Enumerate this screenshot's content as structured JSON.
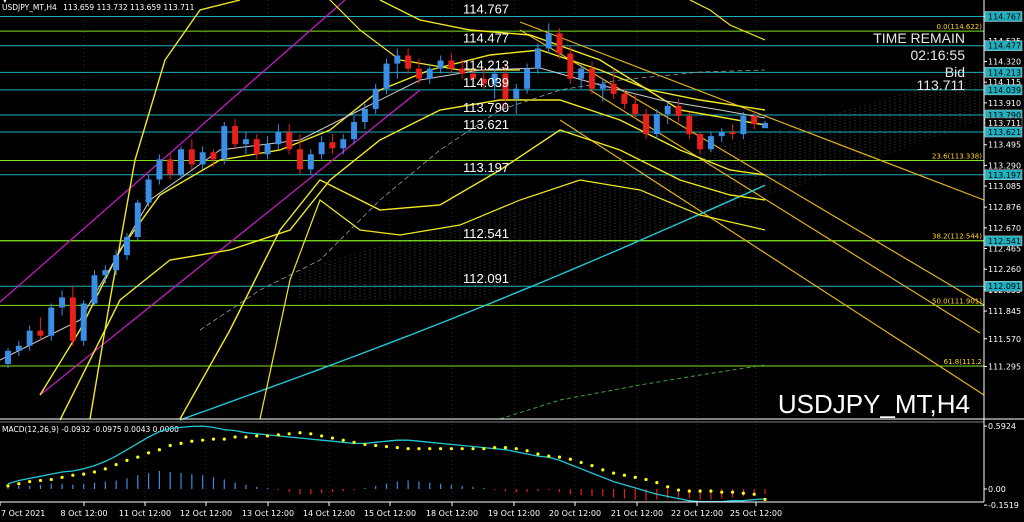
{
  "header": {
    "symbol_tf": "USDJPY_MT,H4",
    "ohlc": "113.659 113.732 113.659 113.711"
  },
  "watermark": "USDJPY_MT,H4",
  "timer": {
    "label": "TIME REMAIN",
    "time": "02:16:55",
    "bid_label": "Bid",
    "bid": "113.711"
  },
  "macd_header": "MACD(12,26,9) -0.0932 -0.0975 0.0043 0.0000",
  "colors": {
    "background": "#000000",
    "bull": "#3a8ee6",
    "bear": "#e8201a",
    "ma_long": "#22c7d6",
    "bands": "#f2ea1f",
    "channel": "#d11ad1",
    "trend": "#e0b21c",
    "hline_cyan": "#1fb0c0",
    "hline_green": "#7ee21f",
    "macd_line": "#22c7d6",
    "macd_signal": "#ffff00"
  },
  "chart_data": [
    {
      "type": "line",
      "title": "USDJPY_MT,H4",
      "x": [
        "7 Oct 2021",
        "8 Oct 12:00",
        "11 Oct 12:00",
        "12 Oct 12:00",
        "13 Oct 12:00",
        "14 Oct 12:00",
        "15 Oct 12:00",
        "18 Oct 12:00",
        "19 Oct 12:00",
        "20 Oct 12:00",
        "21 Oct 12:00",
        "22 Oct 12:00",
        "25 Oct 12:00"
      ],
      "y_ticks": [
        "114.767",
        "114.525",
        "114.320",
        "114.115",
        "113.910",
        "113.711",
        "113.495",
        "113.290",
        "113.085",
        "112.876",
        "112.670",
        "112.465",
        "112.260",
        "112.055",
        "111.845",
        "111.570",
        "111.295"
      ],
      "ylim": [
        111.24,
        114.92
      ],
      "price_lines": [
        {
          "label": "114.767",
          "value": 114.767,
          "color": "cyan"
        },
        {
          "label": "114.477",
          "value": 114.477,
          "color": "cyan"
        },
        {
          "label": "114.213",
          "value": 114.213,
          "color": "cyan"
        },
        {
          "label": "114.039",
          "value": 114.039,
          "color": "cyan"
        },
        {
          "label": "113.790",
          "value": 113.79,
          "color": "cyan"
        },
        {
          "label": "113.621",
          "value": 113.621,
          "color": "cyan"
        },
        {
          "label": "113.197",
          "value": 113.197,
          "color": "cyan"
        },
        {
          "label": "112.541",
          "value": 112.541,
          "color": "green"
        },
        {
          "label": "112.091",
          "value": 112.091,
          "color": "cyan"
        }
      ],
      "right_tags": [
        {
          "label": "114.767",
          "value": 114.767
        },
        {
          "label": "114.477",
          "value": 114.477
        },
        {
          "label": "114.213",
          "value": 114.213
        },
        {
          "label": "114.039",
          "value": 114.039
        },
        {
          "label": "113.790",
          "value": 113.79
        },
        {
          "label": "113.711",
          "value": 113.711
        },
        {
          "label": "113.621",
          "value": 113.621
        },
        {
          "label": "113.197",
          "value": 113.197
        },
        {
          "label": "112.541",
          "value": 112.541
        },
        {
          "label": "112.091",
          "value": 112.091
        }
      ],
      "fibo": [
        {
          "label": "0.0(114.622)",
          "value": 114.622
        },
        {
          "label": "23.6(113.338)",
          "value": 113.338
        },
        {
          "label": "38.2(112.544)",
          "value": 112.544
        },
        {
          "label": "50.0(111.901)",
          "value": 111.901
        },
        {
          "label": "61.8(111.2",
          "value": 111.3
        }
      ],
      "candles": [
        [
          111.32,
          111.48,
          111.28,
          111.45
        ],
        [
          111.45,
          111.55,
          111.4,
          111.5
        ],
        [
          111.5,
          111.7,
          111.45,
          111.65
        ],
        [
          111.65,
          111.78,
          111.55,
          111.6
        ],
        [
          111.6,
          111.92,
          111.55,
          111.88
        ],
        [
          111.88,
          112.05,
          111.8,
          111.98
        ],
        [
          111.98,
          112.1,
          111.5,
          111.55
        ],
        [
          111.55,
          111.95,
          111.5,
          111.92
        ],
        [
          111.92,
          112.25,
          111.9,
          112.2
        ],
        [
          112.2,
          112.3,
          112.12,
          112.25
        ],
        [
          112.25,
          112.45,
          112.2,
          112.4
        ],
        [
          112.4,
          112.62,
          112.35,
          112.58
        ],
        [
          112.58,
          112.95,
          112.55,
          112.92
        ],
        [
          112.92,
          113.2,
          112.88,
          113.15
        ],
        [
          113.15,
          113.4,
          113.1,
          113.35
        ],
        [
          113.35,
          113.42,
          113.15,
          113.2
        ],
        [
          113.2,
          113.48,
          113.15,
          113.45
        ],
        [
          113.45,
          113.55,
          113.25,
          113.3
        ],
        [
          113.3,
          113.48,
          113.25,
          113.42
        ],
        [
          113.42,
          113.45,
          113.28,
          113.35
        ],
        [
          113.35,
          113.72,
          113.3,
          113.68
        ],
        [
          113.68,
          113.75,
          113.45,
          113.5
        ],
        [
          113.5,
          113.62,
          113.4,
          113.55
        ],
        [
          113.55,
          113.6,
          113.35,
          113.4
        ],
        [
          113.4,
          113.58,
          113.35,
          113.5
        ],
        [
          113.5,
          113.7,
          113.45,
          113.62
        ],
        [
          113.62,
          113.7,
          113.4,
          113.45
        ],
        [
          113.45,
          113.6,
          113.2,
          113.25
        ],
        [
          113.25,
          113.45,
          113.2,
          113.4
        ],
        [
          113.4,
          113.58,
          113.35,
          113.52
        ],
        [
          113.52,
          113.6,
          113.4,
          113.46
        ],
        [
          113.46,
          113.6,
          113.4,
          113.55
        ],
        [
          113.55,
          113.78,
          113.5,
          113.72
        ],
        [
          113.72,
          113.9,
          113.65,
          113.85
        ],
        [
          113.85,
          114.1,
          113.8,
          114.05
        ],
        [
          114.05,
          114.35,
          114.0,
          114.3
        ],
        [
          114.3,
          114.45,
          114.15,
          114.38
        ],
        [
          114.38,
          114.45,
          114.2,
          114.25
        ],
        [
          114.25,
          114.35,
          114.1,
          114.15
        ],
        [
          114.15,
          114.3,
          114.1,
          114.25
        ],
        [
          114.25,
          114.38,
          114.2,
          114.33
        ],
        [
          114.33,
          114.4,
          114.2,
          114.25
        ],
        [
          114.25,
          114.35,
          114.15,
          114.2
        ],
        [
          114.2,
          114.3,
          114.1,
          114.15
        ],
        [
          114.15,
          114.25,
          114.05,
          114.1
        ],
        [
          114.1,
          114.25,
          113.95,
          114.2
        ],
        [
          114.2,
          114.3,
          113.85,
          113.95
        ],
        [
          113.95,
          114.1,
          113.8,
          114.05
        ],
        [
          114.05,
          114.3,
          114.0,
          114.25
        ],
        [
          114.25,
          114.5,
          114.2,
          114.45
        ],
        [
          114.45,
          114.7,
          114.4,
          114.6
        ],
        [
          114.6,
          114.65,
          114.35,
          114.4
        ],
        [
          114.4,
          114.48,
          114.1,
          114.15
        ],
        [
          114.15,
          114.3,
          114.05,
          114.25
        ],
        [
          114.25,
          114.32,
          114.0,
          114.05
        ],
        [
          114.05,
          114.15,
          113.92,
          114.1
        ],
        [
          114.1,
          114.25,
          113.95,
          114.0
        ],
        [
          114.0,
          114.05,
          113.85,
          113.9
        ],
        [
          113.9,
          114.0,
          113.75,
          113.8
        ],
        [
          113.8,
          113.85,
          113.55,
          113.6
        ],
        [
          113.6,
          113.85,
          113.55,
          113.8
        ],
        [
          113.8,
          113.92,
          113.7,
          113.88
        ],
        [
          113.88,
          113.95,
          113.72,
          113.78
        ],
        [
          113.78,
          113.82,
          113.55,
          113.6
        ],
        [
          113.6,
          113.62,
          113.4,
          113.45
        ],
        [
          113.45,
          113.62,
          113.42,
          113.58
        ],
        [
          113.58,
          113.66,
          113.52,
          113.62
        ],
        [
          113.62,
          113.7,
          113.55,
          113.6
        ],
        [
          113.6,
          113.82,
          113.55,
          113.78
        ],
        [
          113.78,
          113.82,
          113.65,
          113.7
        ],
        [
          113.659,
          113.732,
          113.659,
          113.711
        ]
      ]
    },
    {
      "type": "bar",
      "title": "MACD(12,26,9) -0.0932 -0.0975 0.0043 0.0000",
      "y_ticks": [
        "0.5924",
        "0.00",
        "-0.1519"
      ],
      "ylim": [
        -0.18,
        0.64
      ],
      "histogram": [
        0.02,
        0.03,
        0.03,
        0.04,
        0.05,
        0.05,
        0.04,
        0.05,
        0.06,
        0.07,
        0.08,
        0.1,
        0.13,
        0.15,
        0.17,
        0.16,
        0.15,
        0.14,
        0.13,
        0.11,
        0.09,
        0.06,
        0.04,
        0.02,
        0.01,
        -0.01,
        -0.03,
        -0.05,
        -0.05,
        -0.04,
        -0.03,
        -0.02,
        -0.01,
        0.01,
        0.03,
        0.05,
        0.07,
        0.08,
        0.07,
        0.06,
        0.05,
        0.04,
        0.03,
        0.02,
        0.01,
        -0.01,
        -0.02,
        -0.03,
        -0.03,
        -0.02,
        -0.01,
        -0.03,
        -0.05,
        -0.06,
        -0.07,
        -0.07,
        -0.08,
        -0.09,
        -0.1,
        -0.11,
        -0.1,
        -0.09,
        -0.08,
        -0.09,
        -0.1,
        -0.1,
        -0.09,
        -0.08,
        -0.07,
        -0.06,
        -0.05
      ],
      "macd": [
        0.05,
        0.08,
        0.1,
        0.12,
        0.14,
        0.16,
        0.17,
        0.19,
        0.22,
        0.26,
        0.31,
        0.37,
        0.43,
        0.49,
        0.54,
        0.57,
        0.58,
        0.59,
        0.5924,
        0.58,
        0.56,
        0.55,
        0.53,
        0.52,
        0.51,
        0.5,
        0.49,
        0.48,
        0.47,
        0.46,
        0.45,
        0.44,
        0.43,
        0.43,
        0.44,
        0.45,
        0.46,
        0.46,
        0.45,
        0.44,
        0.43,
        0.42,
        0.41,
        0.4,
        0.39,
        0.38,
        0.37,
        0.35,
        0.33,
        0.31,
        0.3,
        0.27,
        0.23,
        0.19,
        0.15,
        0.11,
        0.07,
        0.04,
        0.01,
        -0.02,
        -0.05,
        -0.07,
        -0.09,
        -0.11,
        -0.12,
        -0.12,
        -0.12,
        -0.11,
        -0.11,
        -0.1,
        -0.0932
      ],
      "signal": [
        0.03,
        0.05,
        0.07,
        0.08,
        0.09,
        0.11,
        0.13,
        0.14,
        0.16,
        0.19,
        0.23,
        0.27,
        0.3,
        0.34,
        0.37,
        0.41,
        0.43,
        0.45,
        0.46,
        0.47,
        0.47,
        0.49,
        0.49,
        0.5,
        0.5,
        0.51,
        0.52,
        0.53,
        0.52,
        0.5,
        0.48,
        0.46,
        0.44,
        0.42,
        0.41,
        0.4,
        0.39,
        0.38,
        0.38,
        0.38,
        0.38,
        0.38,
        0.38,
        0.38,
        0.38,
        0.39,
        0.39,
        0.38,
        0.36,
        0.33,
        0.31,
        0.3,
        0.28,
        0.25,
        0.22,
        0.18,
        0.15,
        0.13,
        0.11,
        0.09,
        0.06,
        0.02,
        -0.01,
        -0.02,
        -0.02,
        -0.02,
        -0.03,
        -0.03,
        -0.04,
        -0.05,
        -0.0975
      ]
    }
  ]
}
